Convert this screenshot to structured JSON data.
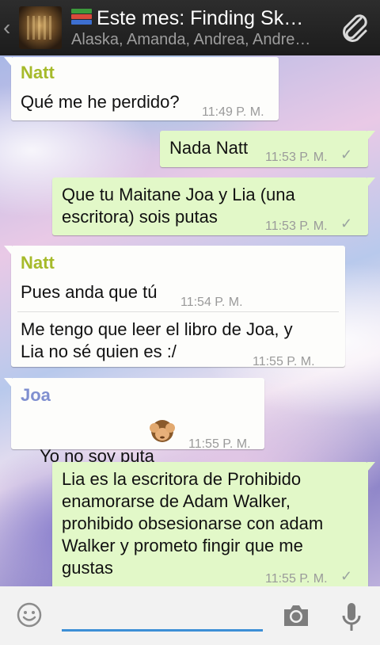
{
  "header": {
    "title": "Este mes: Finding Sk…",
    "subtitle": "Alaska, Amanda, Andrea, Andre…"
  },
  "colors": {
    "header_bg": "#1f1f1f",
    "incoming_bubble": "#fdfdfb",
    "outgoing_bubble": "#e2f8c8",
    "natt_name": "#a6ba2a",
    "joa_name": "#7f8fd0",
    "input_underline": "#3d8fd6"
  },
  "messages": [
    {
      "sender": "Natt",
      "text": "Qué me he perdido?",
      "time": "11:49 P. M."
    },
    {
      "text": "Nada Natt",
      "time": "11:53 P. M."
    },
    {
      "text": "Que tu Maitane Joa y Lia (una\nescritora) sois putas",
      "time": "11:53 P. M."
    },
    {
      "sender": "Natt",
      "text": "Pues anda que tú",
      "time": "11:54 P. M."
    },
    {
      "text": "Me tengo que leer el libro de Joa, y\nLia no sé quien es :/",
      "time": "11:55 P. M."
    },
    {
      "sender": "Joa",
      "text": "Yo no soy puta",
      "emoji": "see-no-evil-monkey",
      "time": "11:55 P. M."
    },
    {
      "text": "Lia es la escritora de Prohibido\nenamorarse de Adam Walker,\nprohibido obsesionarse con adam\nWalker y prometo fingir que me\ngustas",
      "time": "11:55 P. M."
    }
  ],
  "composer": {
    "placeholder": ""
  },
  "icons": [
    "back-chevron-icon",
    "group-avatar",
    "books-emoji-icon",
    "paperclip-icon",
    "smiley-icon",
    "camera-icon",
    "microphone-icon",
    "double-check-icon"
  ]
}
